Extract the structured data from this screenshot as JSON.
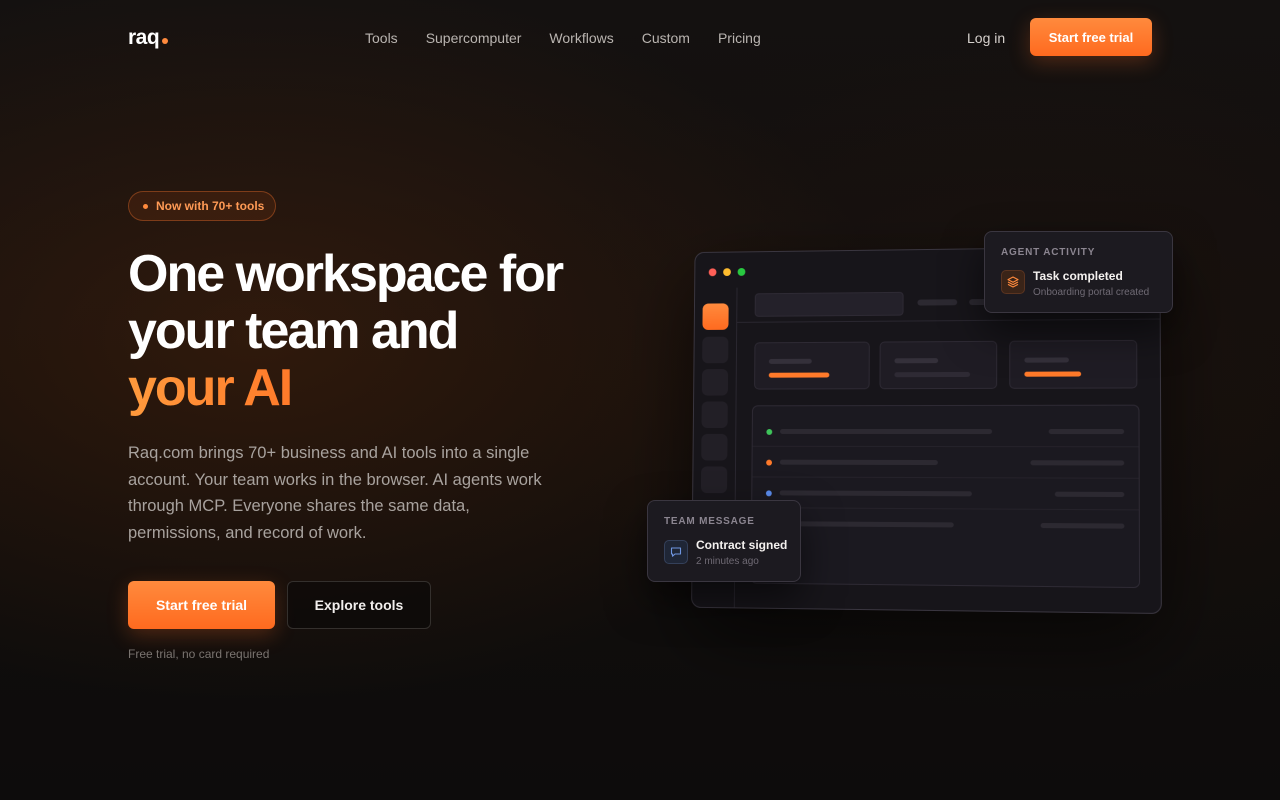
{
  "nav": {
    "logo": "raq",
    "links": [
      "Tools",
      "Supercomputer",
      "Workflows",
      "Custom",
      "Pricing"
    ],
    "login": "Log in",
    "cta": "Start free trial"
  },
  "hero": {
    "badge": "Now with 70+ tools",
    "headline_line1": "One workspace for",
    "headline_line2": "your team and",
    "headline_accent": "your AI",
    "subtext": "Raq.com brings 70+ business and AI tools into a single account. Your team works in the browser. AI agents work through MCP. Everyone shares the same data, permissions, and record of work.",
    "primary_cta": "Start free trial",
    "secondary_cta": "Explore tools",
    "fineprint": "Free trial, no card required"
  },
  "agent_card": {
    "label": "AGENT ACTIVITY",
    "title": "Task completed",
    "subtitle": "Onboarding portal created",
    "icon": "layers-icon"
  },
  "message_card": {
    "label": "TEAM MESSAGE",
    "title": "Contract signed",
    "subtitle": "2 minutes ago",
    "icon": "chat-bubble-icon"
  },
  "colors": {
    "accent": "#ff7a2a",
    "accent_light": "#ff9a3d",
    "background": "#120e0c",
    "status_green": "#3ec45a",
    "status_orange": "#ff7a2a",
    "status_blue": "#5b8def"
  }
}
